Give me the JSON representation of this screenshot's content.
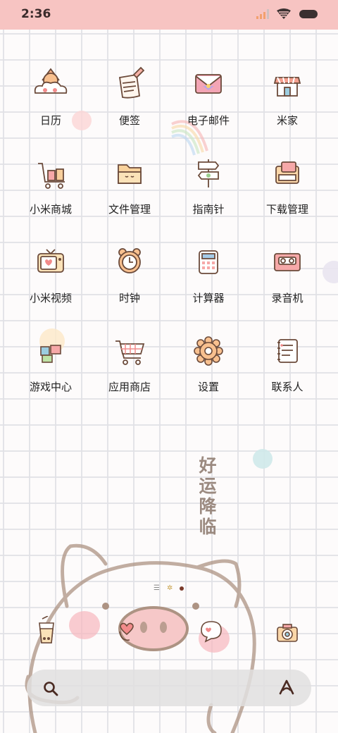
{
  "status_bar": {
    "time": "2:36",
    "icons": [
      "signal-icon",
      "wifi-icon",
      "battery-icon"
    ]
  },
  "apps": [
    {
      "label": "日历",
      "icon": "calendar-sun-icon"
    },
    {
      "label": "便签",
      "icon": "notes-icon"
    },
    {
      "label": "电子邮件",
      "icon": "email-icon"
    },
    {
      "label": "米家",
      "icon": "home-shop-icon"
    },
    {
      "label": "小米商城",
      "icon": "mall-cart-icon"
    },
    {
      "label": "文件管理",
      "icon": "folder-icon"
    },
    {
      "label": "指南针",
      "icon": "signpost-icon"
    },
    {
      "label": "下载管理",
      "icon": "download-box-icon"
    },
    {
      "label": "小米视频",
      "icon": "tv-icon"
    },
    {
      "label": "时钟",
      "icon": "clock-icon"
    },
    {
      "label": "计算器",
      "icon": "calculator-icon"
    },
    {
      "label": "录音机",
      "icon": "cassette-icon"
    },
    {
      "label": "游戏中心",
      "icon": "game-puzzle-icon"
    },
    {
      "label": "应用商店",
      "icon": "shopping-cart-icon"
    },
    {
      "label": "设置",
      "icon": "gear-icon"
    },
    {
      "label": "联系人",
      "icon": "contacts-notebook-icon"
    }
  ],
  "wallpaper": {
    "quote_chars": [
      "好",
      "运",
      "降",
      "临"
    ]
  },
  "page_indicator": {
    "pages": 3,
    "current": 3
  },
  "dock": [
    {
      "icon": "bubble-tea-icon"
    },
    {
      "icon": "phone-heart-icon"
    },
    {
      "icon": "message-bubble-icon"
    },
    {
      "icon": "camera-icon"
    }
  ],
  "search_bar": {
    "search_icon": "search-icon",
    "assistant_icon": "assistant-icon"
  },
  "colors": {
    "status_bar_bg": "#f7c4c2",
    "grid_line": "#e1e1e6",
    "icon_outline": "#6b4a3a",
    "accent_pink": "#f6a8a8"
  }
}
